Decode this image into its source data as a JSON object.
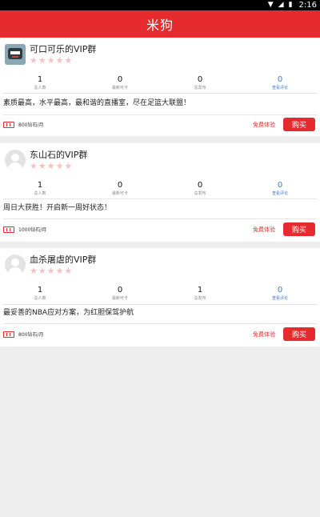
{
  "status_bar": {
    "time": "2:16"
  },
  "app_bar": {
    "title": "米狗"
  },
  "stat_labels": [
    "总人数",
    "最新可卡",
    "总发布",
    "查看评论"
  ],
  "cards": [
    {
      "name": "可口可乐的VIP群",
      "avatar": "cartoon-avatar",
      "stars": 5,
      "stats": [
        "1",
        "0",
        "0",
        "0"
      ],
      "description": "素质最高，水平最高，最和谐的直播室，尽在足篮大联盟！",
      "price": "800钻石/月",
      "trial": "免费体验",
      "buy": "购买"
    },
    {
      "name": "东山石的VIP群",
      "avatar": "default-avatar",
      "stars": 5,
      "stats": [
        "1",
        "0",
        "0",
        "0"
      ],
      "description": "周日大获胜！开启新一周好状态！",
      "price": "1000钻石/月",
      "trial": "免费体验",
      "buy": "购买"
    },
    {
      "name": "血杀屠虐的VIP群",
      "avatar": "default-avatar",
      "stars": 5,
      "stats": [
        "1",
        "0",
        "1",
        "0"
      ],
      "description": "最妥善的NBA应对方案，为红胆保驾护航",
      "price": "800钻石/月",
      "trial": "免费体验",
      "buy": "购买"
    }
  ],
  "colors": {
    "accent": "#e52b2e",
    "link_blue": "#3a7bd5"
  }
}
